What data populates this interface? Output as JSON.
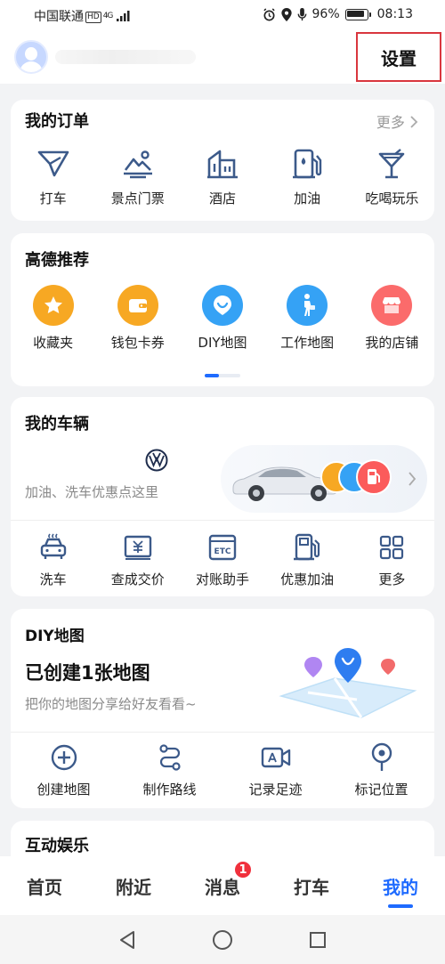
{
  "status_bar": {
    "carrier": "中国联通",
    "hd": "HD",
    "network": "4G",
    "battery": "96%",
    "time": "08:13"
  },
  "header": {
    "settings_label": "设置"
  },
  "orders": {
    "title": "我的订单",
    "more": "更多",
    "items": [
      {
        "label": "打车",
        "icon": "taxi-icon"
      },
      {
        "label": "景点门票",
        "icon": "scenic-ticket-icon"
      },
      {
        "label": "酒店",
        "icon": "hotel-icon"
      },
      {
        "label": "加油",
        "icon": "fuel-icon"
      },
      {
        "label": "吃喝玩乐",
        "icon": "cocktail-icon"
      }
    ]
  },
  "recommend": {
    "title": "高德推荐",
    "items": [
      {
        "label": "收藏夹",
        "icon": "star-icon",
        "color": "#f7a823"
      },
      {
        "label": "钱包卡券",
        "icon": "wallet-icon",
        "color": "#f7a823"
      },
      {
        "label": "DIY地图",
        "icon": "diy-map-icon",
        "color": "#35a2f5"
      },
      {
        "label": "工作地图",
        "icon": "walker-icon",
        "color": "#35a2f5"
      },
      {
        "label": "我的店铺",
        "icon": "shop-icon",
        "color": "#fb6b6b"
      }
    ]
  },
  "vehicle": {
    "title": "我的车辆",
    "promo_text": "加油、洗车优惠点这里",
    "brand_icon": "volkswagen-logo",
    "services": [
      {
        "label": "洗车",
        "icon": "car-wash-icon"
      },
      {
        "label": "查成交价",
        "icon": "price-tag-icon"
      },
      {
        "label": "对账助手",
        "icon": "etc-icon"
      },
      {
        "label": "优惠加油",
        "icon": "fuel-discount-icon"
      },
      {
        "label": "更多",
        "icon": "grid-more-icon"
      }
    ]
  },
  "diy_map": {
    "title": "DIY地图",
    "headline": "已创建1张地图",
    "subtitle": "把你的地图分享给好友看看~",
    "actions": [
      {
        "label": "创建地图",
        "icon": "plus-circle-icon"
      },
      {
        "label": "制作路线",
        "icon": "route-icon"
      },
      {
        "label": "记录足迹",
        "icon": "video-record-icon"
      },
      {
        "label": "标记位置",
        "icon": "map-pin-icon"
      }
    ]
  },
  "entertainment": {
    "title": "互动娱乐"
  },
  "tabbar": {
    "tabs": [
      {
        "label": "首页"
      },
      {
        "label": "附近"
      },
      {
        "label": "消息",
        "badge": "1"
      },
      {
        "label": "打车"
      },
      {
        "label": "我的"
      }
    ],
    "active": "我的",
    "active_color": "#1f6bff",
    "badge_color": "#f0303c"
  },
  "accent_color": "#3c5a8a"
}
